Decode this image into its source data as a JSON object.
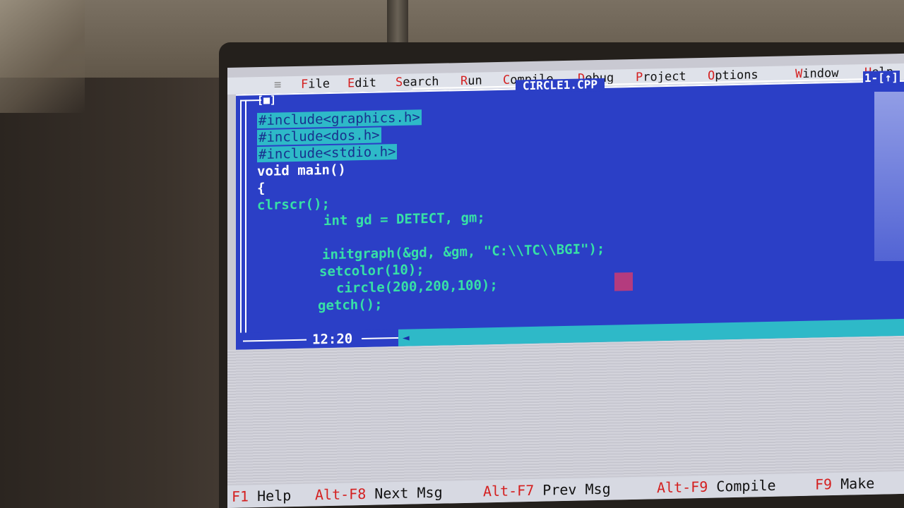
{
  "menu": {
    "items": [
      {
        "hot": "F",
        "rest": "ile"
      },
      {
        "hot": "E",
        "rest": "dit"
      },
      {
        "hot": "S",
        "rest": "earch"
      },
      {
        "hot": "R",
        "rest": "un"
      },
      {
        "hot": "C",
        "rest": "ompile"
      },
      {
        "hot": "D",
        "rest": "ebug"
      },
      {
        "hot": "P",
        "rest": "roject"
      },
      {
        "hot": "O",
        "rest": "ptions"
      },
      {
        "hot": "W",
        "rest": "indow"
      },
      {
        "hot": "H",
        "rest": "elp"
      }
    ]
  },
  "editor": {
    "title": "CIRCLE1.CPP",
    "close_box": "[■]",
    "window_number": "1-[↑]",
    "cursor_position": "12:20",
    "lines": [
      "#include<graphics.h>",
      "#include<dos.h>",
      "#include<stdio.h>",
      "void main()",
      "{",
      "clrscr();",
      "int gd = DETECT, gm;",
      "",
      "initgraph(&gd, &gm, \"C:\\\\TC\\\\BGI\");",
      "setcolor(10);",
      "circle(200,200,100);",
      "getch();",
      "",
      "}"
    ]
  },
  "hints": [
    {
      "key": "F1",
      "label": "Help"
    },
    {
      "key": "Alt-F8",
      "label": "Next Msg"
    },
    {
      "key": "Alt-F7",
      "label": "Prev Msg"
    },
    {
      "key": "Alt-F9",
      "label": "Compile"
    },
    {
      "key": "F9",
      "label": "Make"
    }
  ],
  "colors": {
    "editor_background": "#2b3fc6",
    "selection": "#2eb9c8",
    "string_literal": "#ff2a55",
    "menu_hotkey": "#d42020"
  }
}
